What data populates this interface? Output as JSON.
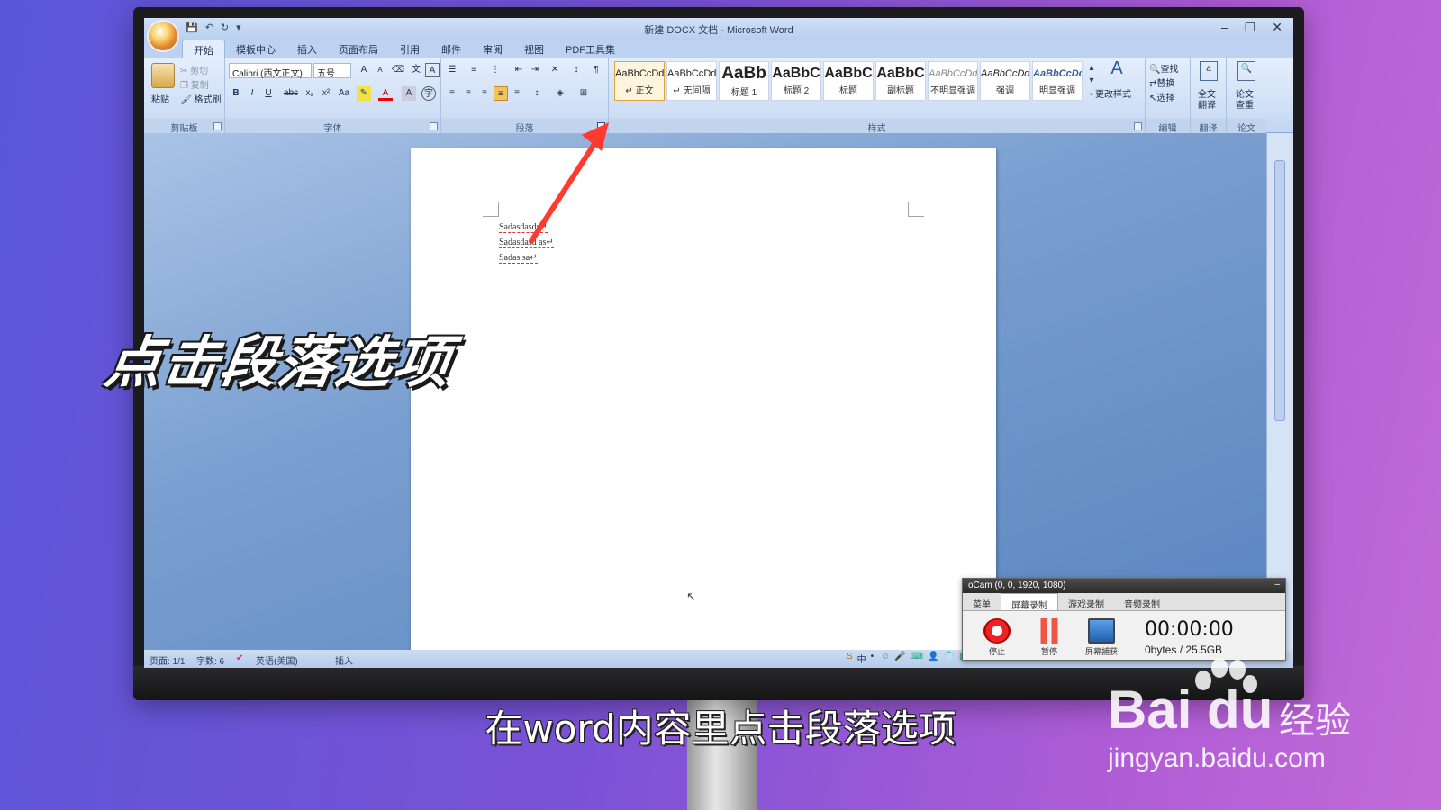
{
  "window": {
    "title": "新建 DOCX 文档 - Microsoft Word",
    "controls": [
      "–",
      "❐",
      "✕"
    ]
  },
  "ribbon_tabs": [
    "开始",
    "模板中心",
    "插入",
    "页面布局",
    "引用",
    "邮件",
    "审阅",
    "视图",
    "PDF工具集"
  ],
  "clipboard": {
    "paste": "粘贴",
    "cut": "剪切",
    "copy": "复制",
    "format_painter": "格式刷",
    "label": "剪贴板"
  },
  "font": {
    "name": "Calibri (西文正文)",
    "size": "五号",
    "label": "字体",
    "bold": "B",
    "italic": "I",
    "underline": "U",
    "strike": "abc",
    "subscript": "x₂",
    "superscript": "x²",
    "case": "Aa",
    "grow": "A",
    "shrink": "A"
  },
  "paragraph": {
    "label": "段落"
  },
  "styles": {
    "label": "样式",
    "items": [
      {
        "sample": "AaBbCcDd",
        "name": "↵ 正文"
      },
      {
        "sample": "AaBbCcDd",
        "name": "↵ 无间隔"
      },
      {
        "sample": "AaBb",
        "name": "标题 1"
      },
      {
        "sample": "AaBbC",
        "name": "标题 2"
      },
      {
        "sample": "AaBbC",
        "name": "标题"
      },
      {
        "sample": "AaBbC",
        "name": "副标题"
      },
      {
        "sample": "AaBbCcDd",
        "name": "不明显强调"
      },
      {
        "sample": "AaBbCcDd",
        "name": "强调"
      },
      {
        "sample": "AaBbCcDd",
        "name": "明显强调"
      }
    ],
    "change_styles": "更改样式"
  },
  "editing": {
    "label": "编辑",
    "find": "查找",
    "replace": "替换",
    "select": "选择"
  },
  "translate": {
    "label": "翻译",
    "full_text": "全文",
    "translate": "翻译"
  },
  "paper": {
    "label": "论文",
    "line1": "论文",
    "line2": "查重"
  },
  "document": {
    "lines": [
      "Sadasdasds↵",
      "Sadasdasd as↵",
      "Sadas   sa↵"
    ]
  },
  "statusbar": {
    "page": "页面: 1/1",
    "words": "字数: 6",
    "language": "英语(美国)",
    "mode": "插入"
  },
  "ocam": {
    "title": "oCam (0, 0, 1920, 1080)",
    "tabs": [
      "菜单",
      "屏幕录制",
      "游戏录制",
      "音频录制"
    ],
    "stop": "停止",
    "pause": "暂停",
    "capture": "屏幕捕获",
    "timer": "00:00:00",
    "size": "0bytes / 25.5GB"
  },
  "overlay": {
    "headline": "点击段落选项",
    "subtitle": "在word内容里点击段落选项"
  },
  "watermark": {
    "logo": "Bai du",
    "cn": "经验",
    "url": "jingyan.baidu.com"
  },
  "colors": {
    "arrow": "#ff3b2f",
    "background_left": "#5a56d8",
    "background_right": "#c26ad8"
  }
}
